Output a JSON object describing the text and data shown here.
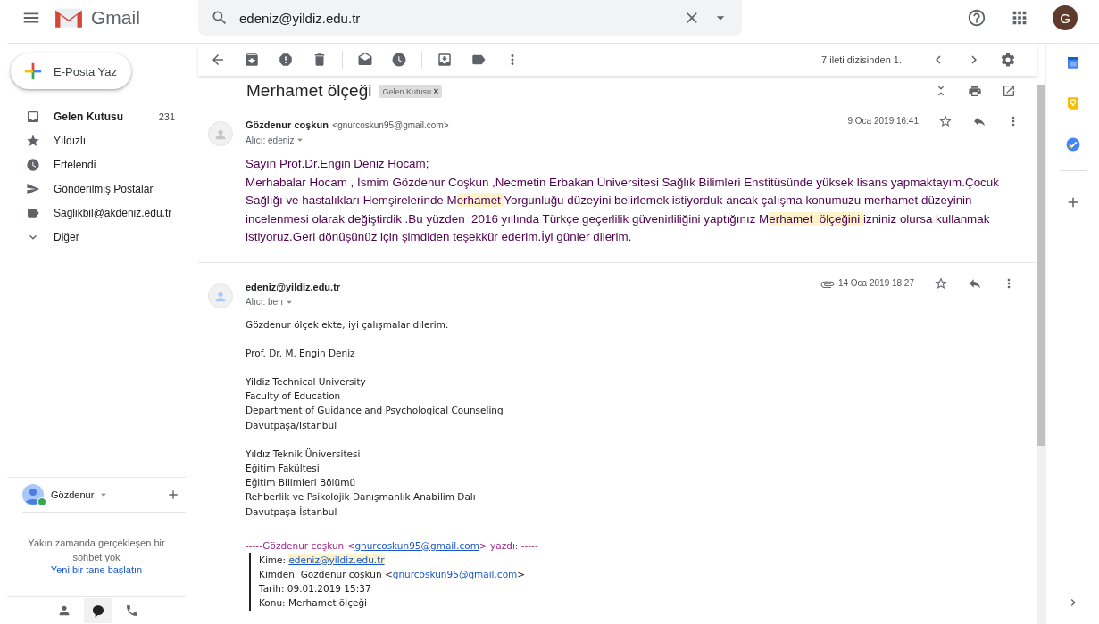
{
  "header": {
    "app_name": "Gmail",
    "search_value": "edeniz@yildiz.edu.tr",
    "avatar_letter": "G"
  },
  "compose": "E-Posta Yaz",
  "nav": [
    {
      "label": "Gelen Kutusu",
      "count": "231",
      "unread": true
    },
    {
      "label": "Yıldızlı",
      "unread": false
    },
    {
      "label": "Ertelendi",
      "unread": false
    },
    {
      "label": "Gönderilmiş Postalar",
      "unread": false
    },
    {
      "label": "Saglikbil@akdeniz.edu.tr",
      "unread": false
    },
    {
      "label": "Diğer",
      "unread": false
    }
  ],
  "chat": {
    "user": "Gözdenur",
    "online": true,
    "empty_text": "Yakın zamanda gerçekleşen bir sohbet yok",
    "link": "Yeni bir tane başlatın"
  },
  "toolbar": {
    "counter": "7 ileti dizisinden 1."
  },
  "thread": {
    "subject": "Merhamet ölçeği",
    "label": "Gelen Kutusu",
    "label_close": "×"
  },
  "messages": [
    {
      "kind": "plain",
      "sender": "Gözdenur coşkun",
      "email": "<gnurcoskun95@gmail.com>",
      "to": "Alıcı: edeniz",
      "date": "9 Oca 2019 16:41",
      "attachment": false,
      "paragraphs": [
        [
          {
            "text": "Sayın Prof.Dr.Engin Deniz Hocam;",
            "highlighted": false
          }
        ],
        [
          {
            "text": "Merhabalar Hocam , İsmim Gözdenur Coşkun ,Necmetin Erbakan Üniversitesi Sağlık Bilimleri Enstitüsünde yüksek lisans yapmaktayım.Çocuk Sağlığı ve hastalıkları Hemşirelerinde M",
            "highlighted": false
          },
          {
            "text": "erhamet ",
            "highlighted": true
          },
          {
            "text": "Yorgunluğu düzeyini belirlemek istiyorduk ancak çalışma konumuzu merhamet düzeyinin incelenmesi olarak değiştirdik .Bu yüzden  2016 yıllında Türkçe geçerlilik güvenirliliğini yaptığınız M",
            "highlighted": false
          },
          {
            "text": "erhamet  ölçeğini ",
            "highlighted": true
          },
          {
            "text": "izniniz olursa kullanmak istiyoruz.Geri dönüşünüz için şimdiden teşekkür ederim.İyi günler dilerim.",
            "highlighted": false
          }
        ]
      ]
    },
    {
      "kind": "signature",
      "sender": "edeniz@yildiz.edu.tr",
      "to": "Alıcı: ben",
      "date": "14 Oca 2019 18:27",
      "attachment": true,
      "blocks": [
        [
          "Gözdenur ölçek ekte, iyi çalışmalar dilerim."
        ],
        [
          "Prof. Dr. M. Engin Deniz"
        ],
        [
          "Yildiz Technical University",
          "Faculty of Education",
          "Department of Guidance and Psychological Counseling",
          "Davutpaşa/Istanbul"
        ],
        [
          "Yıldız Teknik Üniversitesi",
          "Eğitim Fakültesi",
          "Eğitim Bilimleri Bölümü",
          "Rehberlik ve Psikolojik Danışmanlık Anabilim Dalı",
          "Davutpaşa-İstanbul"
        ]
      ],
      "quote": {
        "intro_before": "-----Gözdenur coşkun <",
        "intro_link": "gnurcoskun95@gmail.com",
        "intro_after": "> yazdı: -----",
        "lines": [
          {
            "label": "Kime:",
            "link": "edeniz@yildiz.edu.tr",
            "link_highlighted": true
          },
          {
            "label": "Kimden:",
            "text": "Gözdenur coşkun <",
            "link": "gnurcoskun95@gmail.com",
            "after": ">",
            "link_highlighted": false
          },
          {
            "label": "Tarih:",
            "text": "09.01.2019 15:37"
          },
          {
            "label": "Konu:",
            "text": "Merhamet ölçeği"
          }
        ]
      }
    }
  ]
}
